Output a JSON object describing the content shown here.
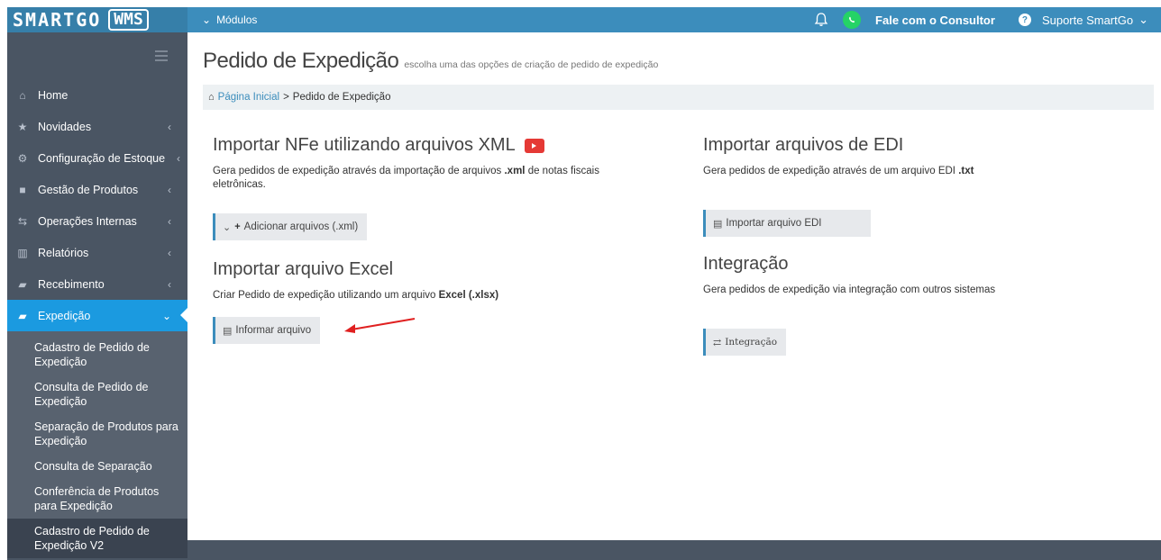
{
  "topbar": {
    "brand": "SMARTGO",
    "product": "WMS",
    "modules_label": "Módulos",
    "consultant_label": "Fale com o Consultor",
    "support_label": "Suporte SmartGo",
    "accent": "#3c8dbc"
  },
  "sidebar": {
    "items": [
      {
        "label": "Home",
        "icon": "home-icon"
      },
      {
        "label": "Novidades",
        "icon": "star-icon"
      },
      {
        "label": "Configuração de Estoque",
        "icon": "cogs-icon"
      },
      {
        "label": "Gestão de Produtos",
        "icon": "box-icon"
      },
      {
        "label": "Operações Internas",
        "icon": "transfer-icon"
      },
      {
        "label": "Relatórios",
        "icon": "bar-chart-icon"
      },
      {
        "label": "Recebimento",
        "icon": "truck-icon"
      },
      {
        "label": "Expedição",
        "icon": "truck-icon"
      }
    ],
    "subitems": [
      {
        "label": "Cadastro de Pedido de Expedição"
      },
      {
        "label": "Consulta de Pedido de Expedição"
      },
      {
        "label": "Separação de Produtos para Expedição"
      },
      {
        "label": "Consulta de Separação"
      },
      {
        "label": "Conferência de Produtos para Expedição"
      },
      {
        "label": "Cadastro de Pedido de Expedição V2"
      }
    ],
    "active_color": "#1b9ae0"
  },
  "page": {
    "title": "Pedido de Expedição",
    "subtitle": "escolha uma das opções de criação de pedido de expedição",
    "breadcrumb_home": "Página Inicial",
    "breadcrumb_sep": ">",
    "breadcrumb_current": "Pedido de Expedição"
  },
  "sections": {
    "xml": {
      "title": "Importar NFe utilizando arquivos XML",
      "desc_pre": "Gera pedidos de expedição através da importação de arquivos ",
      "desc_bold": ".xml",
      "desc_post": " de notas fiscais eletrônicas.",
      "button": "Adicionar arquivos (.xml)"
    },
    "edi": {
      "title": "Importar arquivos de EDI",
      "desc_pre": "Gera pedidos de expedição através de um arquivo EDI ",
      "desc_bold": ".txt",
      "button": "Importar arquivo EDI"
    },
    "excel": {
      "title": "Importar arquivo Excel",
      "desc_pre": "Criar Pedido de expedição utilizando um arquivo ",
      "desc_bold": "Excel (.xlsx)",
      "button": "Informar arquivo"
    },
    "integration": {
      "title": "Integração",
      "desc": "Gera pedidos de expedição via integração com outros sistemas",
      "button": "Integração"
    }
  }
}
